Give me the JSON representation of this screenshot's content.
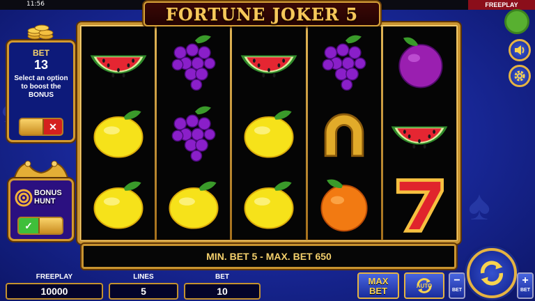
{
  "status": {
    "time": "11:56",
    "mode_tag": "FREEPLAY"
  },
  "title": "FORTUNE JOKER 5",
  "bet_boost": {
    "label": "BET",
    "value": "13",
    "description": "Select an option to boost the BONUS",
    "toggle_icon": "x-icon"
  },
  "bonus_hunt": {
    "label_line1": "BONUS",
    "label_line2": "HUNT",
    "toggle_icon": "check-icon"
  },
  "reels": [
    [
      "watermelon",
      "lemon",
      "lemon"
    ],
    [
      "grapes",
      "grapes",
      "lemon"
    ],
    [
      "watermelon",
      "lemon",
      "lemon"
    ],
    [
      "grapes",
      "horseshoe",
      "orange"
    ],
    [
      "plum",
      "watermelon",
      "seven"
    ]
  ],
  "info_bar": "MIN. BET 5 - MAX. BET 650",
  "bottom": {
    "freeplay_label": "FREEPLAY",
    "freeplay_value": "10000",
    "lines_label": "LINES",
    "lines_value": "5",
    "bet_label": "BET",
    "bet_value": "10",
    "max_bet_line1": "MAX",
    "max_bet_line2": "BET",
    "auto_label": "AUTO",
    "bet_minus_symbol": "−",
    "bet_plus_symbol": "+",
    "bet_minus_label": "BET",
    "bet_plus_label": "BET"
  },
  "side_icons": [
    "status-indicator",
    "sound-icon",
    "settings-icon"
  ],
  "colors": {
    "gold": "#d2992f",
    "background": "#1a2a9e",
    "info_text": "#f4d06c",
    "accent_yellow": "#f8d34f"
  }
}
